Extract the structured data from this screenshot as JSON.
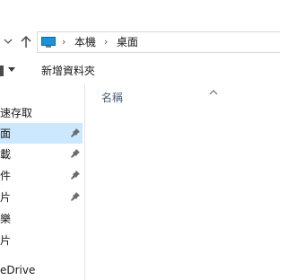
{
  "address": {
    "location_icon": "this-pc-icon",
    "crumbs": [
      "本機",
      "桌面"
    ],
    "separator": "›"
  },
  "toolbar": {
    "view_partial": "​",
    "new_folder_label": "新增資料夾"
  },
  "nav": {
    "items": [
      {
        "label": "速存取",
        "pinned": false
      },
      {
        "label": "面",
        "pinned": true,
        "selected": true
      },
      {
        "label": "載",
        "pinned": true
      },
      {
        "label": "件",
        "pinned": true
      },
      {
        "label": "片",
        "pinned": true
      },
      {
        "label": "樂",
        "pinned": false
      },
      {
        "label": "片",
        "pinned": false
      },
      {
        "label": "eDrive",
        "pinned": false
      }
    ]
  },
  "content": {
    "column_header": "名稱",
    "sort_indicator": "up"
  },
  "colors": {
    "selection": "#cce8ff",
    "accent": "#1e90d6",
    "header_text": "#4c607a"
  }
}
